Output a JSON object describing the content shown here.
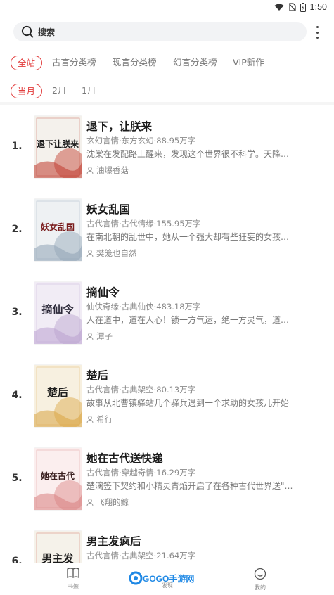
{
  "status_bar": {
    "time": "1:50",
    "icons": [
      "wifi-icon",
      "no-sim-icon",
      "battery-icon"
    ]
  },
  "search": {
    "label": "搜索"
  },
  "category_tabs": [
    {
      "label": "全站",
      "active": true
    },
    {
      "label": "古言分类榜",
      "active": false
    },
    {
      "label": "现言分类榜",
      "active": false
    },
    {
      "label": "幻言分类榜",
      "active": false
    },
    {
      "label": "VIP新作",
      "active": false
    }
  ],
  "month_tabs": [
    {
      "label": "当月",
      "active": true
    },
    {
      "label": "2月",
      "active": false
    },
    {
      "label": "1月",
      "active": false
    }
  ],
  "books": [
    {
      "rank": "1.",
      "title": "退下，让朕来",
      "meta": "玄幻言情·东方玄幻·88.95万字",
      "desc": "沈棠在发配路上醒来，发现这个世界很不科学。天降…",
      "author": "油爆香菇"
    },
    {
      "rank": "2.",
      "title": "妖女乱国",
      "meta": "古代言情·古代情缘·155.95万字",
      "desc": "在南北朝的乱世中，她从一个强大却有些狂妄的女孩…",
      "author": "樊笼也自然"
    },
    {
      "rank": "3.",
      "title": "摘仙令",
      "meta": "仙侠奇缘·古典仙侠·483.18万字",
      "desc": "人在道中，道在人心！锁一方气运，绝一方灵气，道…",
      "author": "潭子"
    },
    {
      "rank": "4.",
      "title": "楚后",
      "meta": "古代言情·古典架空·80.13万字",
      "desc": "故事从北曹镇驿站几个驿兵遇到一个求助的女孩儿开始",
      "author": "希行"
    },
    {
      "rank": "5.",
      "title": "她在古代送快递",
      "meta": "古代言情·穿越奇情·16.29万字",
      "desc": "楚漓签下契约和小精灵青焰开启了在各种古代世界送\"…",
      "author": "飞翔的鲸"
    },
    {
      "rank": "6.",
      "title": "男主发疯后",
      "meta": "古代言情·古典架空·21.64万字",
      "desc": "",
      "author": ""
    }
  ],
  "covers": [
    {
      "text": "退下让朕来",
      "bg": "#f4f1ec",
      "ink": "#1a1a1a",
      "accent": "#c0392b"
    },
    {
      "text": "妖女乱国",
      "bg": "#eef1f3",
      "ink": "#7a1d1d",
      "accent": "#8fa3b5"
    },
    {
      "text": "摘仙令",
      "bg": "#f1ecf5",
      "ink": "#2d2a3a",
      "accent": "#b9a1cf"
    },
    {
      "text": "楚后",
      "bg": "#f7f0e0",
      "ink": "#1d1d1d",
      "accent": "#d9a441"
    },
    {
      "text": "她在古代",
      "bg": "#fbeeee",
      "ink": "#3a2020",
      "accent": "#d98080"
    },
    {
      "text": "男主发",
      "bg": "#f5f2ea",
      "ink": "#1a1a1a",
      "accent": "#c94a3a"
    }
  ],
  "bottom_nav": [
    {
      "label": "书架",
      "icon": "bookshelf-icon"
    },
    {
      "label": "发现",
      "icon": "discover-icon"
    },
    {
      "label": "我的",
      "icon": "profile-icon"
    }
  ],
  "watermark": {
    "text": "GOGO手游网"
  },
  "colors": {
    "accent": "#e23c3c",
    "logo_blue": "#1e88e5"
  }
}
